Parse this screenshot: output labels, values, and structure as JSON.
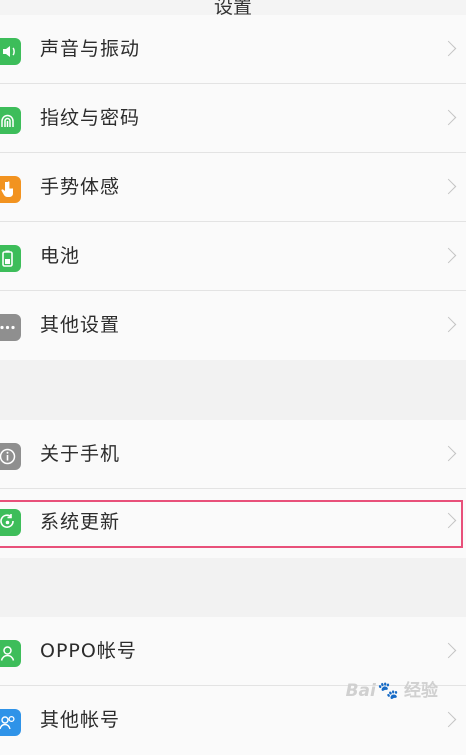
{
  "header": {
    "title": "设置"
  },
  "group1": [
    {
      "label": "声音与振动",
      "icon": "speaker-icon",
      "color": "#3dbd5a"
    },
    {
      "label": "指纹与密码",
      "icon": "fingerprint-icon",
      "color": "#3dbd5a"
    },
    {
      "label": "手势体感",
      "icon": "hand-gesture-icon",
      "color": "#f29320"
    },
    {
      "label": "电池",
      "icon": "battery-icon",
      "color": "#3dbd5a"
    },
    {
      "label": "其他设置",
      "icon": "more-dots-icon",
      "color": "#8f8f8f"
    }
  ],
  "group2": [
    {
      "label": "关于手机",
      "icon": "info-icon",
      "color": "#8f8f8f"
    },
    {
      "label": "系统更新",
      "icon": "update-icon",
      "color": "#3dbd5a",
      "highlighted": true
    }
  ],
  "group3": [
    {
      "label": "OPPO帐号",
      "icon": "account-icon",
      "color": "#3dbd5a"
    },
    {
      "label": "其他帐号",
      "icon": "accounts-icon",
      "color": "#2f93e8"
    }
  ],
  "watermark": {
    "brand": "Bai",
    "brand2": "经验",
    "paw": "🐾"
  }
}
